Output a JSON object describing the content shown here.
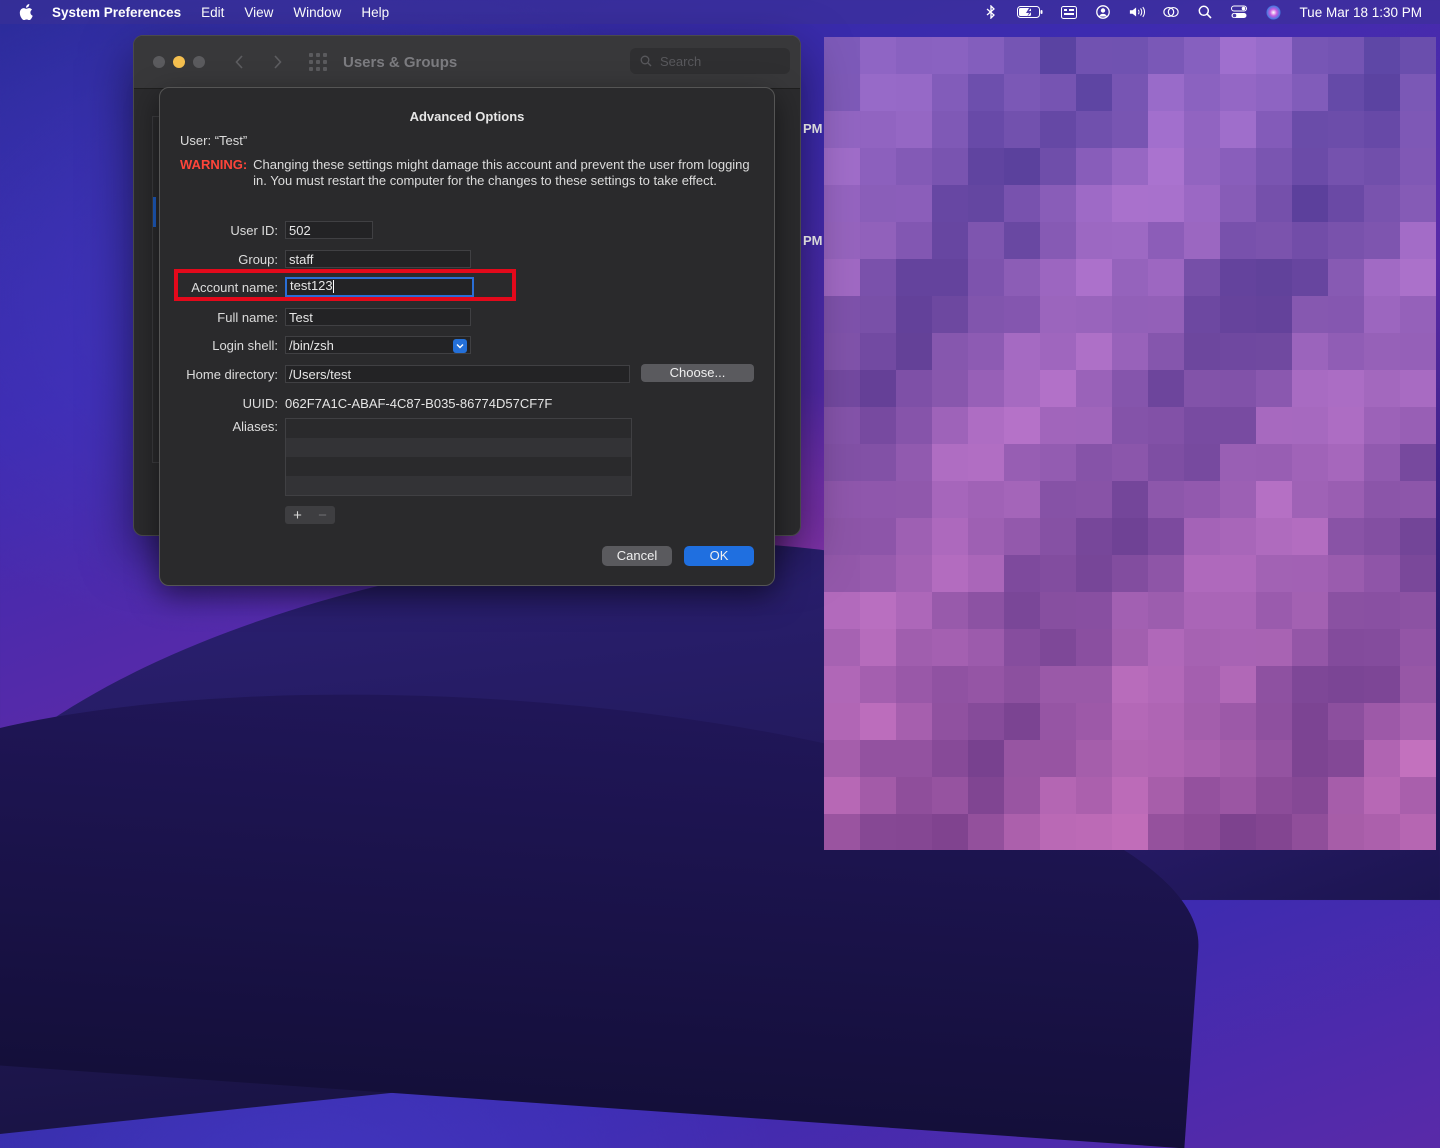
{
  "menubar": {
    "app_name": "System Preferences",
    "items": [
      "Edit",
      "View",
      "Window",
      "Help"
    ],
    "clock": "Tue Mar 18  1:30 PM"
  },
  "window": {
    "title": "Users & Groups",
    "search_placeholder": "Search",
    "bg_time_1": "PM",
    "bg_time_2": "PM"
  },
  "sheet": {
    "title": "Advanced Options",
    "user_label": "User:",
    "user_value": "“Test”",
    "warning_label": "WARNING:",
    "warning_text": "Changing these settings might damage this account and prevent the user from logging in. You must restart the computer for the changes to these settings to take effect.",
    "fields": {
      "user_id": {
        "label": "User ID:",
        "value": "502"
      },
      "group": {
        "label": "Group:",
        "value": "staff"
      },
      "account_name": {
        "label": "Account name:",
        "value": "test123"
      },
      "full_name": {
        "label": "Full name:",
        "value": "Test"
      },
      "login_shell": {
        "label": "Login shell:",
        "value": "/bin/zsh"
      },
      "home_directory": {
        "label": "Home directory:",
        "value": "/Users/test"
      },
      "uuid": {
        "label": "UUID:",
        "value": "062F7A1C-ABAF-4C87-B035-86774D57CF7F"
      },
      "aliases": {
        "label": "Aliases:"
      }
    },
    "choose_label": "Choose...",
    "add_label": "+",
    "remove_label": "−",
    "cancel_label": "Cancel",
    "ok_label": "OK"
  },
  "colors": {
    "accent": "#1f6fe0",
    "warning": "#ff453a",
    "highlight_box": "#e3091b"
  }
}
